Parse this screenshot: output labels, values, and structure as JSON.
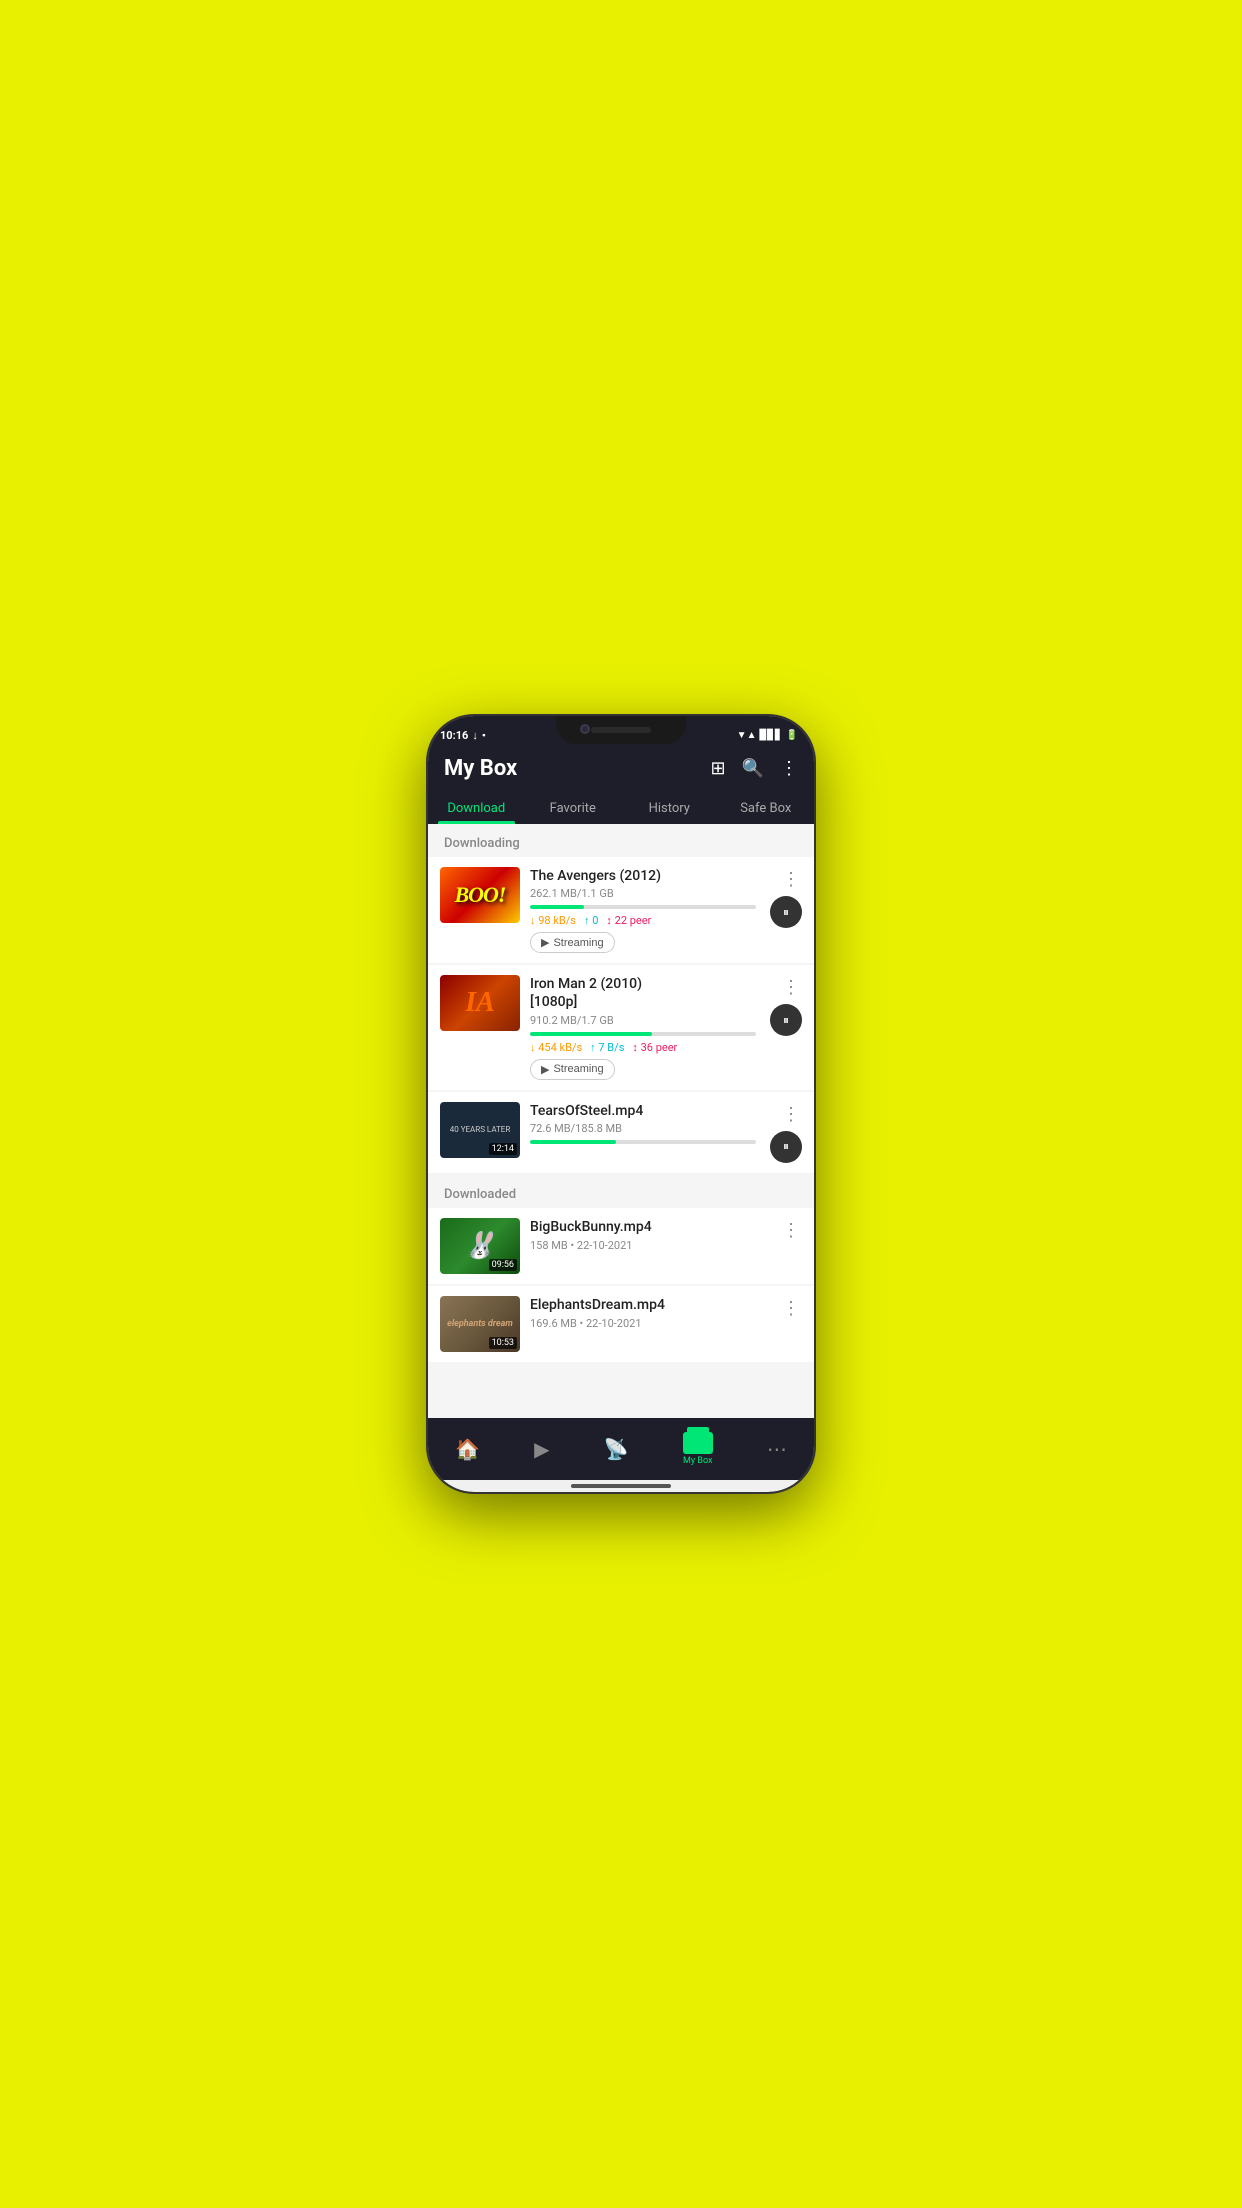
{
  "status": {
    "time": "10:16",
    "wifi": "▼",
    "signal_bars": "▲",
    "dot": "•"
  },
  "header": {
    "title": "My Box",
    "grid_icon": "⊞",
    "search_icon": "🔍",
    "more_icon": "⋮"
  },
  "tabs": [
    {
      "label": "Download",
      "active": true
    },
    {
      "label": "Favorite",
      "active": false
    },
    {
      "label": "History",
      "active": false
    },
    {
      "label": "Safe Box",
      "active": false
    }
  ],
  "sections": {
    "downloading": {
      "header": "Downloading",
      "items": [
        {
          "name": "The Avengers (2012)",
          "size": "262.1 MB/1.1 GB",
          "progress": 24,
          "speed_down": "98 kB/s",
          "speed_up": "0",
          "peers": "22 peer",
          "has_streaming": true
        },
        {
          "name": "Iron Man 2 (2010)\n[1080p]",
          "size": "910.2 MB/1.7 GB",
          "progress": 54,
          "speed_down": "454 kB/s",
          "speed_up": "7 B/s",
          "peers": "36 peer",
          "has_streaming": true
        },
        {
          "name": "TearsOfSteel.mp4",
          "size": "72.6 MB/185.8 MB",
          "progress": 38,
          "has_streaming": false,
          "duration": "12:14"
        }
      ]
    },
    "downloaded": {
      "header": "Downloaded",
      "items": [
        {
          "name": "BigBuckBunny.mp4",
          "size": "158 MB",
          "date": "22-10-2021",
          "duration": "09:56"
        },
        {
          "name": "ElephantsDream.mp4",
          "size": "169.6 MB",
          "date": "22-10-2021",
          "duration": "10:53"
        }
      ]
    }
  },
  "bottom_nav": [
    {
      "label": "Home",
      "icon": "🏠",
      "active": false
    },
    {
      "label": "",
      "icon": "▶",
      "active": false
    },
    {
      "label": "",
      "icon": "📡",
      "active": false
    },
    {
      "label": "My Box",
      "icon": "mybox",
      "active": true
    },
    {
      "label": "",
      "icon": "⋯",
      "active": false
    }
  ],
  "streaming_label": "Streaming",
  "pause_icon": "⏸"
}
